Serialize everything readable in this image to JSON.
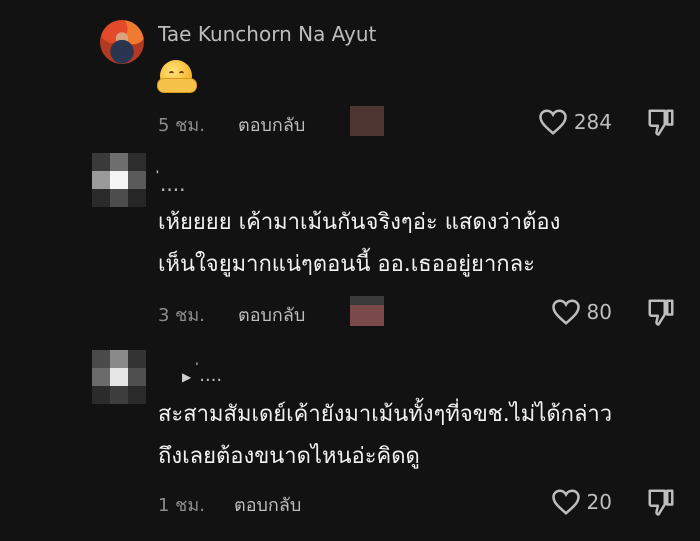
{
  "comments": [
    {
      "author": "Tae Kunchorn Na Ayut",
      "text_lines": [],
      "emoji": "hugging-face",
      "time": "5 ชม.",
      "reply_label": "ตอบกลับ",
      "likes": "284"
    },
    {
      "author": "่....",
      "text_lines": [
        "เห้ยยยย เค้ามาเม้นกันจริงๆอ่ะ แสดงว่าต้อง",
        "เห็นใจยูมากแน่ๆตอนนี้ ออ.เธออยู่ยากละ"
      ],
      "time": "3 ชม.",
      "reply_label": "ตอบกลับ",
      "likes": "80"
    },
    {
      "author": "่....",
      "reply_indicator": "▶",
      "text_lines": [
        "สะสามสัมเดย์เค้ายังมาเม้นทั้งๆที่จขช.ไม่ได้กล่าว",
        "ถึงเลยต้องขนาดไหนอ่ะคิดดู"
      ],
      "time": "1 ชม.",
      "reply_label": "ตอบกลับ",
      "likes": "20"
    }
  ],
  "colors": {
    "background": "#121212",
    "text": "#f2f2f2",
    "muted": "#8c8c8c",
    "icon": "#bdbdbd"
  }
}
